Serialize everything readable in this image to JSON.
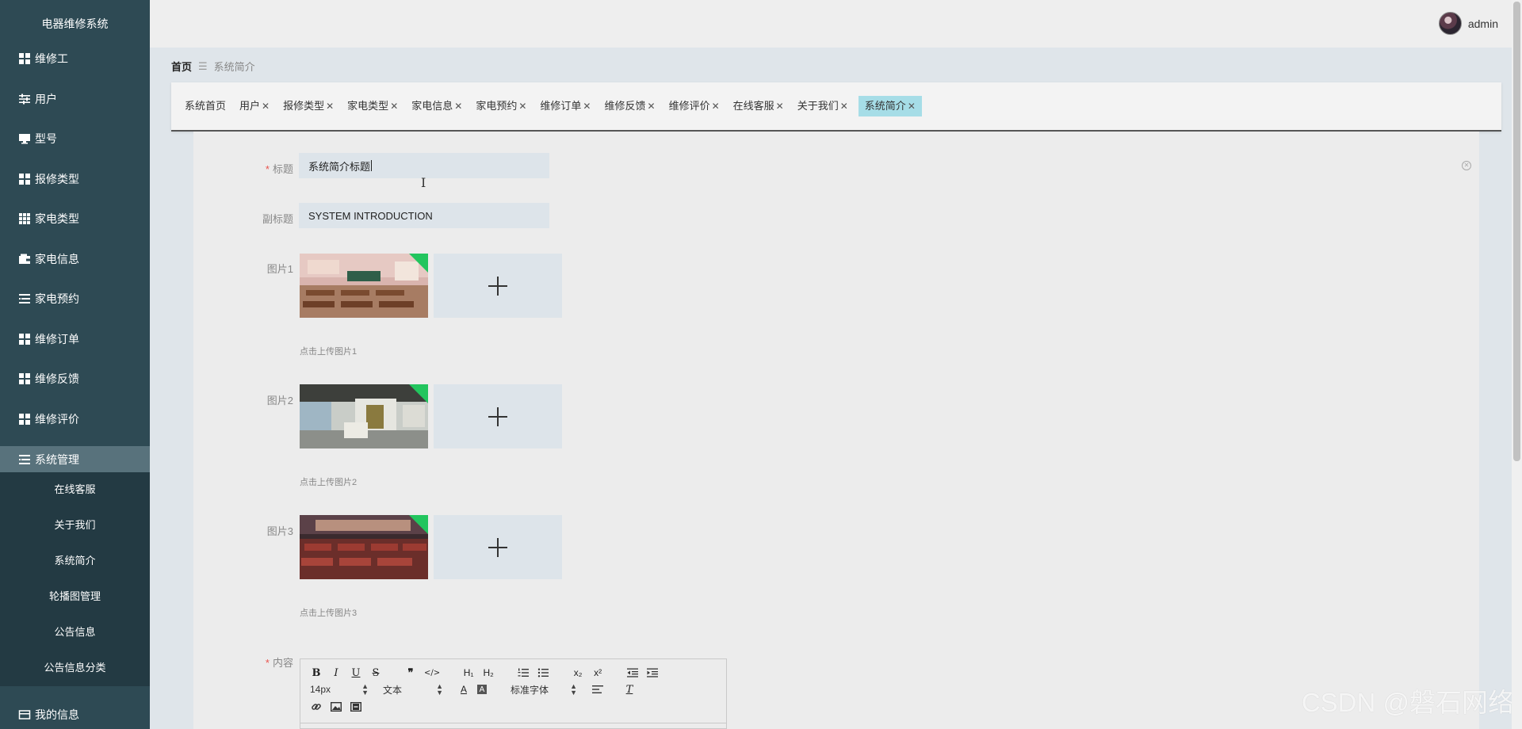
{
  "app": {
    "title": "电器维修系统"
  },
  "sidebar": {
    "items": [
      {
        "label": "维修工",
        "icon": "grid-icon"
      },
      {
        "label": "用户",
        "icon": "sliders-icon"
      },
      {
        "label": "型号",
        "icon": "monitor-icon"
      },
      {
        "label": "报修类型",
        "icon": "grid-icon"
      },
      {
        "label": "家电类型",
        "icon": "grid9-icon"
      },
      {
        "label": "家电信息",
        "icon": "wallet-icon"
      },
      {
        "label": "家电预约",
        "icon": "list-icon"
      },
      {
        "label": "维修订单",
        "icon": "grid-icon"
      },
      {
        "label": "维修反馈",
        "icon": "grid-icon"
      },
      {
        "label": "维修评价",
        "icon": "grid-icon"
      },
      {
        "label": "系统管理",
        "icon": "list-icon"
      }
    ],
    "sub_items": [
      "在线客服",
      "关于我们",
      "系统简介",
      "轮播图管理",
      "公告信息",
      "公告信息分类"
    ],
    "bottom_item": {
      "label": "我的信息",
      "icon": "card-icon"
    }
  },
  "header": {
    "username": "admin"
  },
  "breadcrumb": {
    "home": "首页",
    "separator": "☰",
    "current": "系统简介"
  },
  "tabs": [
    {
      "label": "系统首页",
      "closable": false
    },
    {
      "label": "用户",
      "closable": true
    },
    {
      "label": "报修类型",
      "closable": true
    },
    {
      "label": "家电类型",
      "closable": true
    },
    {
      "label": "家电信息",
      "closable": true
    },
    {
      "label": "家电预约",
      "closable": true
    },
    {
      "label": "维修订单",
      "closable": true
    },
    {
      "label": "维修反馈",
      "closable": true
    },
    {
      "label": "维修评价",
      "closable": true
    },
    {
      "label": "在线客服",
      "closable": true
    },
    {
      "label": "关于我们",
      "closable": true
    },
    {
      "label": "系统简介",
      "closable": true,
      "active": true
    }
  ],
  "form": {
    "title_label": "标题",
    "title_value": "系统简介标题",
    "subtitle_label": "副标题",
    "subtitle_value": "SYSTEM INTRODUCTION",
    "images": [
      {
        "label": "图片1",
        "hint": "点击上传图片1"
      },
      {
        "label": "图片2",
        "hint": "点击上传图片2"
      },
      {
        "label": "图片3",
        "hint": "点击上传图片3"
      }
    ],
    "content_label": "内容"
  },
  "editor": {
    "font_size": "14px",
    "header_select": "文本",
    "font_family": "标准字体"
  },
  "watermark": "CSDN @磐石网络",
  "colors": {
    "sidebar": "#2e4a54",
    "active_tab": "#a6dde7",
    "required": "#e9544f",
    "uploaded_marker": "#22c55e"
  }
}
